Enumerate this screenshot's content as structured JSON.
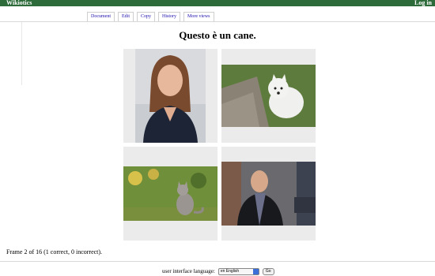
{
  "header": {
    "brand": "Wikiotics",
    "login": "Log in"
  },
  "tabs": [
    {
      "label": "Document"
    },
    {
      "label": "Edit"
    },
    {
      "label": "Copy"
    },
    {
      "label": "History"
    },
    {
      "label": "More views"
    }
  ],
  "main": {
    "title": "Questo è un cane.",
    "status": "Frame 2 of 16 (1 correct, 0 incorrect)."
  },
  "footer": {
    "language_label": "user interface language:",
    "language_selected": "en English",
    "go_label": "Go"
  },
  "colors": {
    "header_bg": "#2e6b3a",
    "link": "#1a0dab"
  }
}
